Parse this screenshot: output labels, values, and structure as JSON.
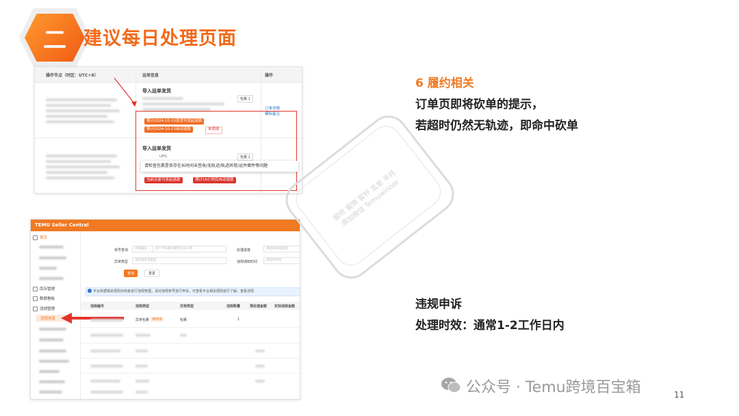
{
  "header": {
    "section_number": "二",
    "title": "建议每日处理页面"
  },
  "right": {
    "section1": {
      "title": "6 履约相关",
      "lines": [
        "订单页即将砍单的提示，",
        "若超时仍然无轨迹，即命中砍单"
      ]
    },
    "section2": {
      "title": "违规申诉",
      "lines": [
        "处理时效：通常1-2工作日内"
      ]
    }
  },
  "shot1": {
    "col_node": "操作节点（时区：UTC+8）",
    "col_info": "运单信息",
    "col_action": "操作",
    "import_label": "导入运单发货",
    "parcel_count": "包裹 1",
    "carrier": "UPS",
    "link_order_detail": "订单详情",
    "link_mark": "模拟备注",
    "tag_1": "预计2024-10-10发货可发起退款",
    "tag_2": "预计2024-10-13自动退款",
    "tag_3": "未揽收",
    "tooltip": "请检查包裹是否存在长时间未签收/无轨迹/轨迹异常/运件面件等问题",
    "tag_4": "当前买家可发起退款",
    "tag_5": "预计16小时后自动退款"
  },
  "shot2": {
    "topbar": "TEMU Seller Central",
    "side_home": "首页",
    "side_stock": "库存管理",
    "side_data": "数据看板",
    "side_violation": "违规管理",
    "side_violation_sub": "违规信息",
    "f_label1": "单号查询",
    "f_select1": "违规编号",
    "f_ph1": "多个单号最多使用逗号分割",
    "f_label2": "处理进度",
    "f_ph2": "请选择处理进度",
    "f_label3": "异常类型",
    "f_ph3": "请选择异常类型",
    "f_label4": "违规通知时间",
    "f_ph4": "请选择时间",
    "btn_search": "查询",
    "btn_reset": "重置",
    "notice": "平台依据相关规则对商家进行违规管理，请对违规单号进行申诉，可查看平台相关规则进行了解，查看详情",
    "th": [
      "违规编号",
      "违规类型",
      "异常类型",
      "违规数量",
      "预处理金额",
      "实际违规金额"
    ],
    "row1": {
      "type": "异常包裹",
      "badge": "待申诉",
      "kind": "包裹",
      "qty": "1"
    }
  },
  "stamp": {
    "line1": "窗帘 窗饰 窗杆 五金 半托",
    "line2": "添加微信 Temuwinner"
  },
  "watermark": "公众号 · Temu跨境百宝箱",
  "page_number": "11",
  "colors": {
    "accent": "#f07a22",
    "alert": "#d9362d"
  }
}
